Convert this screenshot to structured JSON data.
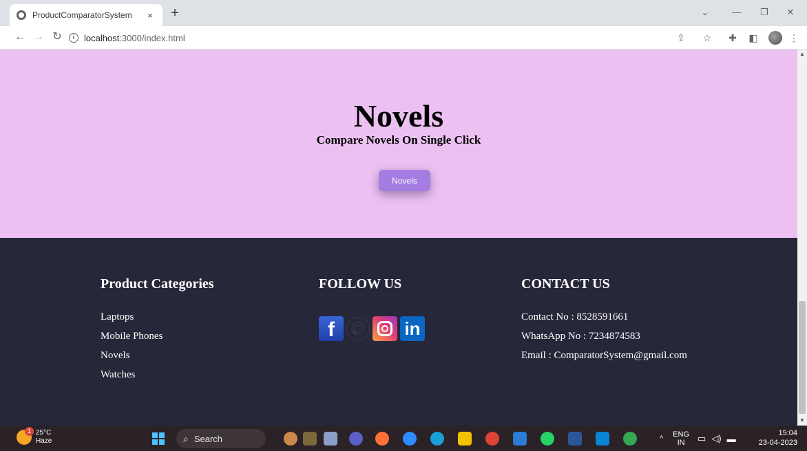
{
  "browser": {
    "tab_title": "ProductComparatorSystem",
    "tab_close": "×",
    "new_tab": "+",
    "url_host": "localhost",
    "url_path": ":3000/index.html"
  },
  "hero": {
    "title": "Novels",
    "subtitle": "Compare Novels On Single Click",
    "button_label": "Novels",
    "background": "#ecc1f2",
    "button_color": "#a57ce2"
  },
  "footer": {
    "background": "#27273a",
    "categories": {
      "heading": "Product Categories",
      "items": [
        "Laptops",
        "Mobile Phones",
        "Novels",
        "Watches"
      ]
    },
    "follow": {
      "heading": "FOLLOW US",
      "icons": [
        "facebook-icon",
        "github-icon",
        "instagram-icon",
        "linkedin-icon"
      ],
      "facebook_glyph": "f",
      "linkedin_glyph": "in"
    },
    "contact": {
      "heading": "CONTACT US",
      "items": [
        "Contact No : 8528591661",
        "WhatsApp No : 7234874583",
        "Email : ComparatorSystem@gmail.com"
      ]
    }
  },
  "taskbar": {
    "weather_temp": "25°C",
    "weather_desc": "Haze",
    "weather_badge": "1",
    "search_label": "Search",
    "lang_top": "ENG",
    "lang_bottom": "IN",
    "time": "15:04",
    "date": "23-04-2023"
  }
}
